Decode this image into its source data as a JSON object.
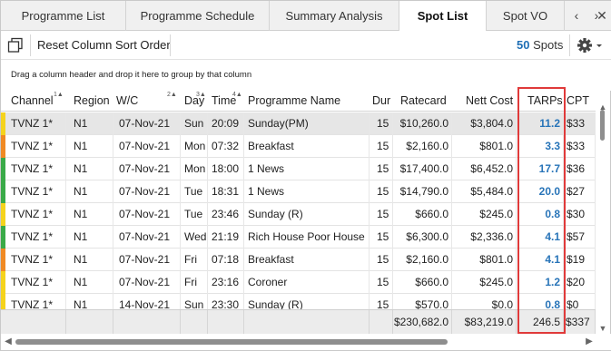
{
  "tabs": [
    {
      "label": "Programme List",
      "active": false
    },
    {
      "label": "Programme Schedule",
      "active": false
    },
    {
      "label": "Summary Analysis",
      "active": false
    },
    {
      "label": "Spot List",
      "active": true
    },
    {
      "label": "Spot VO",
      "active": false
    }
  ],
  "tab_nav": {
    "prev": "‹",
    "next": "›",
    "close": "✕"
  },
  "toolbar": {
    "copy_icon": "copy-icon",
    "reset_label": "Reset Column Sort Order",
    "spot_count": "50",
    "spot_label": "Spots",
    "settings_icon": "gear-icon"
  },
  "group_panel": {
    "hint": "Drag a column header and drop it here to group by that column"
  },
  "grid": {
    "columns": [
      {
        "key": "channel",
        "label": "Channel",
        "sort": "1▲"
      },
      {
        "key": "region",
        "label": "Region",
        "sort": ""
      },
      {
        "key": "wc",
        "label": "W/C",
        "sort": "2▲"
      },
      {
        "key": "day",
        "label": "Day",
        "sort": "3▲"
      },
      {
        "key": "time",
        "label": "Time",
        "sort": "4▲"
      },
      {
        "key": "programme",
        "label": "Programme Name",
        "sort": ""
      },
      {
        "key": "dur",
        "label": "Dur",
        "sort": ""
      },
      {
        "key": "ratecard",
        "label": "Ratecard",
        "sort": ""
      },
      {
        "key": "nett",
        "label": "Nett Cost",
        "sort": ""
      },
      {
        "key": "tarps",
        "label": "TARPs",
        "sort": ""
      },
      {
        "key": "cpt",
        "label": "CPT",
        "sort": ""
      }
    ],
    "rows": [
      {
        "stripe": "#f5d31d",
        "channel": "TVNZ 1*",
        "region": "N1",
        "wc": "07-Nov-21",
        "day": "Sun",
        "time": "20:09",
        "programme": "Sunday(PM)",
        "dur": "15",
        "ratecard": "$10,260.0",
        "nett": "$3,804.0",
        "tarps": "11.2",
        "cpt": "$33"
      },
      {
        "stripe": "#f08a24",
        "channel": "TVNZ 1*",
        "region": "N1",
        "wc": "07-Nov-21",
        "day": "Mon",
        "time": "07:32",
        "programme": "Breakfast",
        "dur": "15",
        "ratecard": "$2,160.0",
        "nett": "$801.0",
        "tarps": "3.3",
        "cpt": "$33"
      },
      {
        "stripe": "#3aaa48",
        "channel": "TVNZ 1*",
        "region": "N1",
        "wc": "07-Nov-21",
        "day": "Mon",
        "time": "18:00",
        "programme": "1 News",
        "dur": "15",
        "ratecard": "$17,400.0",
        "nett": "$6,452.0",
        "tarps": "17.7",
        "cpt": "$36"
      },
      {
        "stripe": "#3aaa48",
        "channel": "TVNZ 1*",
        "region": "N1",
        "wc": "07-Nov-21",
        "day": "Tue",
        "time": "18:31",
        "programme": "1 News",
        "dur": "15",
        "ratecard": "$14,790.0",
        "nett": "$5,484.0",
        "tarps": "20.0",
        "cpt": "$27"
      },
      {
        "stripe": "#f5d31d",
        "channel": "TVNZ 1*",
        "region": "N1",
        "wc": "07-Nov-21",
        "day": "Tue",
        "time": "23:46",
        "programme": "Sunday (R)",
        "dur": "15",
        "ratecard": "$660.0",
        "nett": "$245.0",
        "tarps": "0.8",
        "cpt": "$30"
      },
      {
        "stripe": "#3aaa48",
        "channel": "TVNZ 1*",
        "region": "N1",
        "wc": "07-Nov-21",
        "day": "Wed",
        "time": "21:19",
        "programme": "Rich House Poor House",
        "dur": "15",
        "ratecard": "$6,300.0",
        "nett": "$2,336.0",
        "tarps": "4.1",
        "cpt": "$57"
      },
      {
        "stripe": "#f08a24",
        "channel": "TVNZ 1*",
        "region": "N1",
        "wc": "07-Nov-21",
        "day": "Fri",
        "time": "07:18",
        "programme": "Breakfast",
        "dur": "15",
        "ratecard": "$2,160.0",
        "nett": "$801.0",
        "tarps": "4.1",
        "cpt": "$19"
      },
      {
        "stripe": "#f5d31d",
        "channel": "TVNZ 1*",
        "region": "N1",
        "wc": "07-Nov-21",
        "day": "Fri",
        "time": "23:16",
        "programme": "Coroner",
        "dur": "15",
        "ratecard": "$660.0",
        "nett": "$245.0",
        "tarps": "1.2",
        "cpt": "$20"
      },
      {
        "stripe": "#f5d31d",
        "channel": "TVNZ 1*",
        "region": "N1",
        "wc": "14-Nov-21",
        "day": "Sun",
        "time": "23:30",
        "programme": "Sunday (R)",
        "dur": "15",
        "ratecard": "$570.0",
        "nett": "$0.0",
        "tarps": "0.8",
        "cpt": "$0"
      }
    ],
    "totals": {
      "ratecard": "$230,682.0",
      "nett": "$83,219.0",
      "tarps": "246.5",
      "cpt": "$337"
    }
  }
}
